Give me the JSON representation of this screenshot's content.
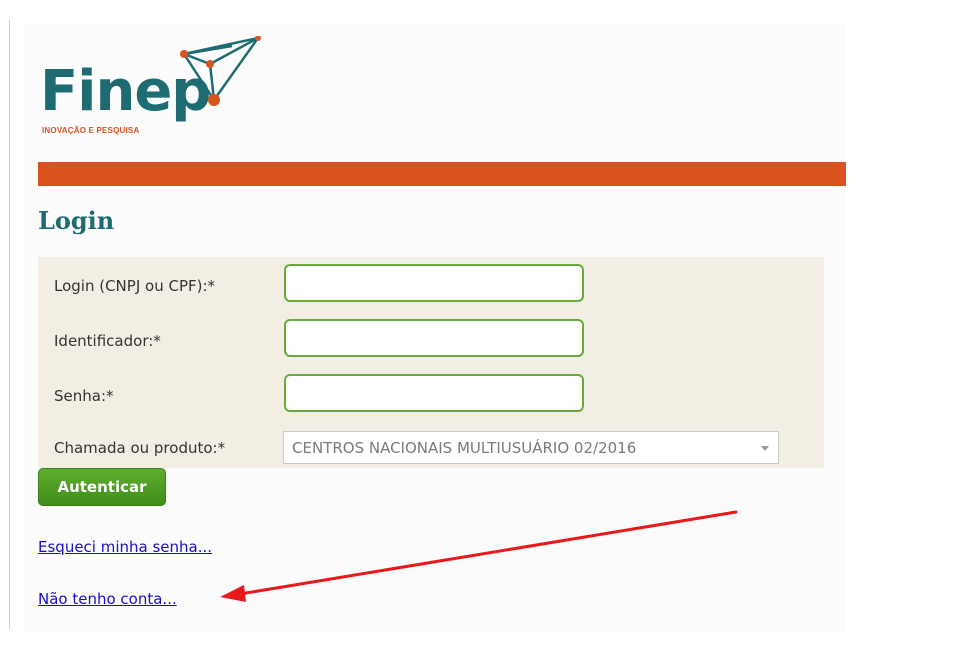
{
  "logo": {
    "name": "Finep",
    "tagline": "INOVAÇÃO E PESQUISA"
  },
  "page": {
    "title": "Login"
  },
  "form": {
    "login_label": "Login (CNPJ ou CPF):*",
    "login_value": "",
    "identifier_label": "Identificador:*",
    "identifier_value": "",
    "password_label": "Senha:*",
    "password_value": "",
    "call_label": "Chamada ou produto:*",
    "call_selected": "CENTROS NACIONAIS MULTIUSUÁRIO 02/2016"
  },
  "actions": {
    "authenticate_label": "Autenticar"
  },
  "links": {
    "forgot_password": "Esqueci minha senha...",
    "no_account": "Não tenho conta..."
  },
  "colors": {
    "brand_teal": "#1e6b72",
    "brand_orange": "#d9531e",
    "button_green": "#4a9a22",
    "input_border": "#6aaa3a",
    "form_background": "#f2eee3",
    "annotation_red": "#e8191c"
  },
  "icons": {
    "dropdown": "chevron-down-icon",
    "annotation": "red-arrow-icon"
  }
}
